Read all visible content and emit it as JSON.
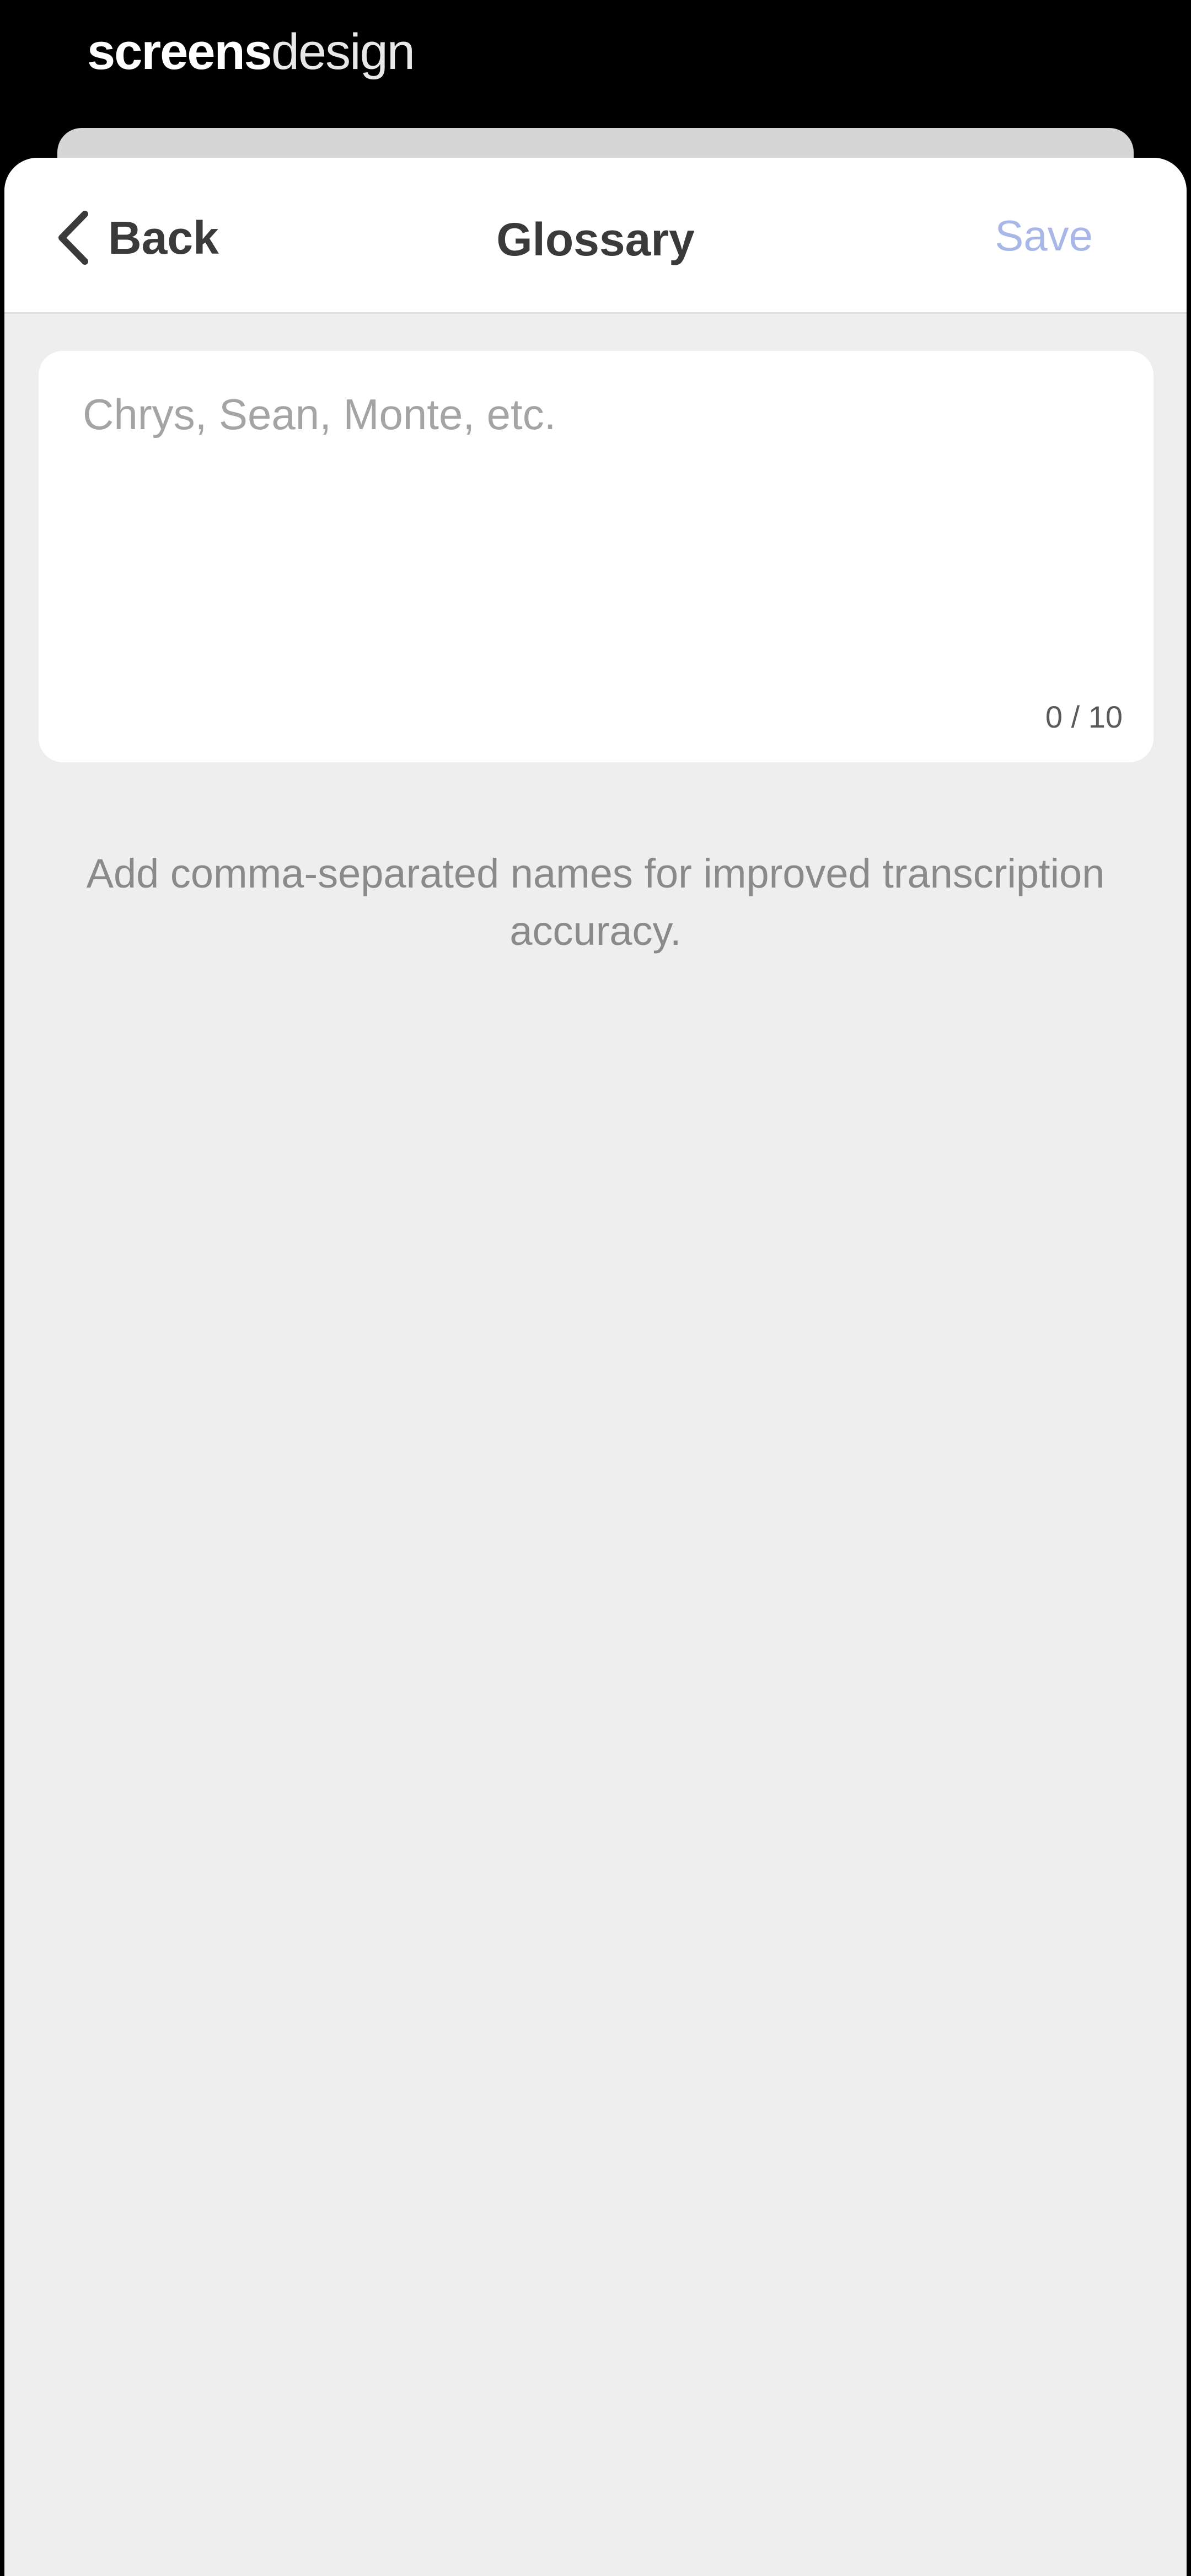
{
  "watermark": {
    "bold": "screens",
    "thin": "design"
  },
  "navbar": {
    "back_label": "Back",
    "title": "Glossary",
    "save_label": "Save"
  },
  "glossary": {
    "value": "",
    "placeholder": "Chrys, Sean, Monte, etc.",
    "counter": "0 / 10"
  },
  "helper_text": "Add comma-separated names for improved transcription accuracy.",
  "colors": {
    "background": "#eeeeee",
    "card": "#ffffff",
    "save_disabled": "#a9b7e8",
    "title_text": "#3a3a3a"
  },
  "icons": {
    "back": "chevron-left-icon"
  }
}
